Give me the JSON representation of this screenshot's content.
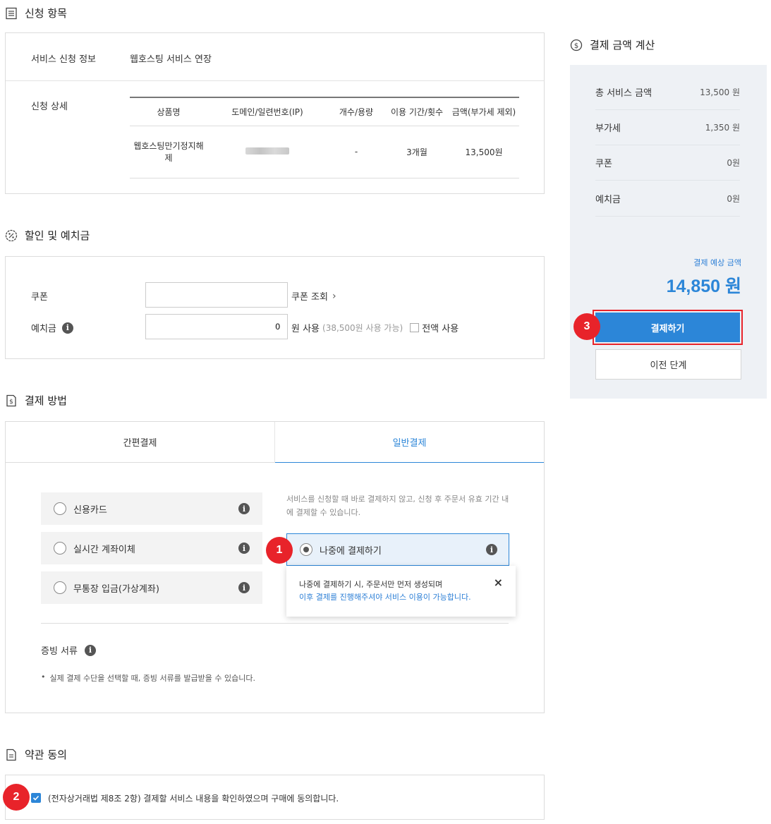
{
  "sections": {
    "application": "신청 항목",
    "discount": "할인 및 예치금",
    "payment_method": "결제 방법",
    "terms": "약관 동의",
    "summary": "결제 금액 계산"
  },
  "application": {
    "service_label": "서비스 신청 정보",
    "service_value": "웹호스팅 서비스 연장",
    "detail_label": "신청 상세",
    "columns": [
      "상품명",
      "도메인/일련번호(IP)",
      "개수/용량",
      "이용 기간/횟수",
      "금액(부가세 제외)"
    ],
    "row": {
      "product_line1": "웹호스팅만기정지해",
      "product_line2": "제",
      "quantity": "-",
      "period": "3개월",
      "amount": "13,500원"
    }
  },
  "discount": {
    "coupon_label": "쿠폰",
    "coupon_value": "",
    "coupon_link": "쿠폰 조회",
    "deposit_label": "예치금",
    "deposit_value": "0",
    "deposit_unit": "원 사용",
    "deposit_available": "(38,500원 사용 가능)",
    "use_all_label": "전액 사용"
  },
  "payment": {
    "tabs": [
      "간편결제",
      "일반결제"
    ],
    "active_tab": 1,
    "methods": [
      "신용카드",
      "실시간 계좌이체",
      "무통장 입금(가상계좌)"
    ],
    "notice": "서비스를 신청할 때 바로 결제하지 않고, 신청 후 주문서 유효 기간 내에 결제할 수 있습니다.",
    "later_option": "나중에 결제하기",
    "tooltip_line1": "나중에 결제하기 시, 주문서만 먼저 생성되며",
    "tooltip_line2": "이후 결제를 진행해주셔야 서비스 이용이 가능합니다.",
    "tooltip_close": "×",
    "receipt_label": "증빙 서류",
    "receipt_note": "실제 결제 수단을 선택할 때, 증빙 서류를 발급받을 수 있습니다."
  },
  "terms": {
    "agree_text": "(전자상거래법 제8조 2항) 결제할 서비스 내용을 확인하였으며 구매에 동의합니다.",
    "checked": true
  },
  "summary": {
    "rows": [
      {
        "label": "총 서비스 금액",
        "value": "13,500 원"
      },
      {
        "label": "부가세",
        "value": "1,350 원"
      },
      {
        "label": "쿠폰",
        "value": "0원"
      },
      {
        "label": "예치금",
        "value": "0원"
      }
    ],
    "expected_label": "결제 예상 금액",
    "expected_amount": "14,850 원",
    "pay_button": "결제하기",
    "prev_button": "이전 단계"
  },
  "badges": [
    "1",
    "2",
    "3"
  ],
  "colors": {
    "accent": "#2c86d8",
    "badge": "#e8232a",
    "highlight": "#e8232a",
    "orange": "#f07c2a",
    "sidebar_bg": "#eef1f5"
  }
}
